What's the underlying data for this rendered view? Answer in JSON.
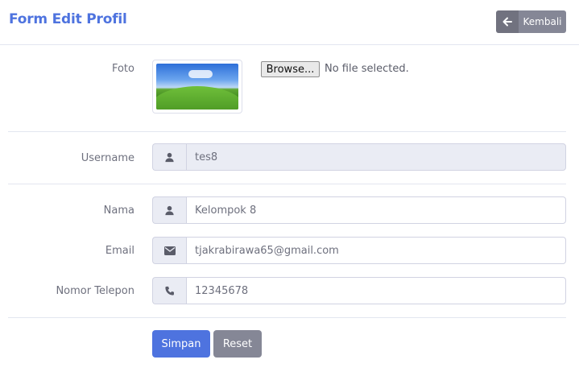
{
  "header": {
    "title": "Form Edit Profil",
    "back_label": "Kembali",
    "back_icon": "arrow-left-icon"
  },
  "photo": {
    "label": "Foto",
    "image_desc": "profile-photo",
    "browse_label": "Browse...",
    "file_status": "No file selected."
  },
  "username": {
    "label": "Username",
    "icon": "user-icon",
    "value": "tes8"
  },
  "nama": {
    "label": "Nama",
    "icon": "user-icon",
    "value": "Kelompok 8"
  },
  "email": {
    "label": "Email",
    "icon": "envelope-icon",
    "value": "tjakrabirawa65@gmail.com"
  },
  "phone": {
    "label": "Nomor Telepon",
    "icon": "phone-icon",
    "value": "12345678"
  },
  "actions": {
    "save_label": "Simpan",
    "reset_label": "Reset"
  },
  "colors": {
    "primary": "#4e73df",
    "secondary": "#858796",
    "addon_bg": "#eaecf4"
  }
}
